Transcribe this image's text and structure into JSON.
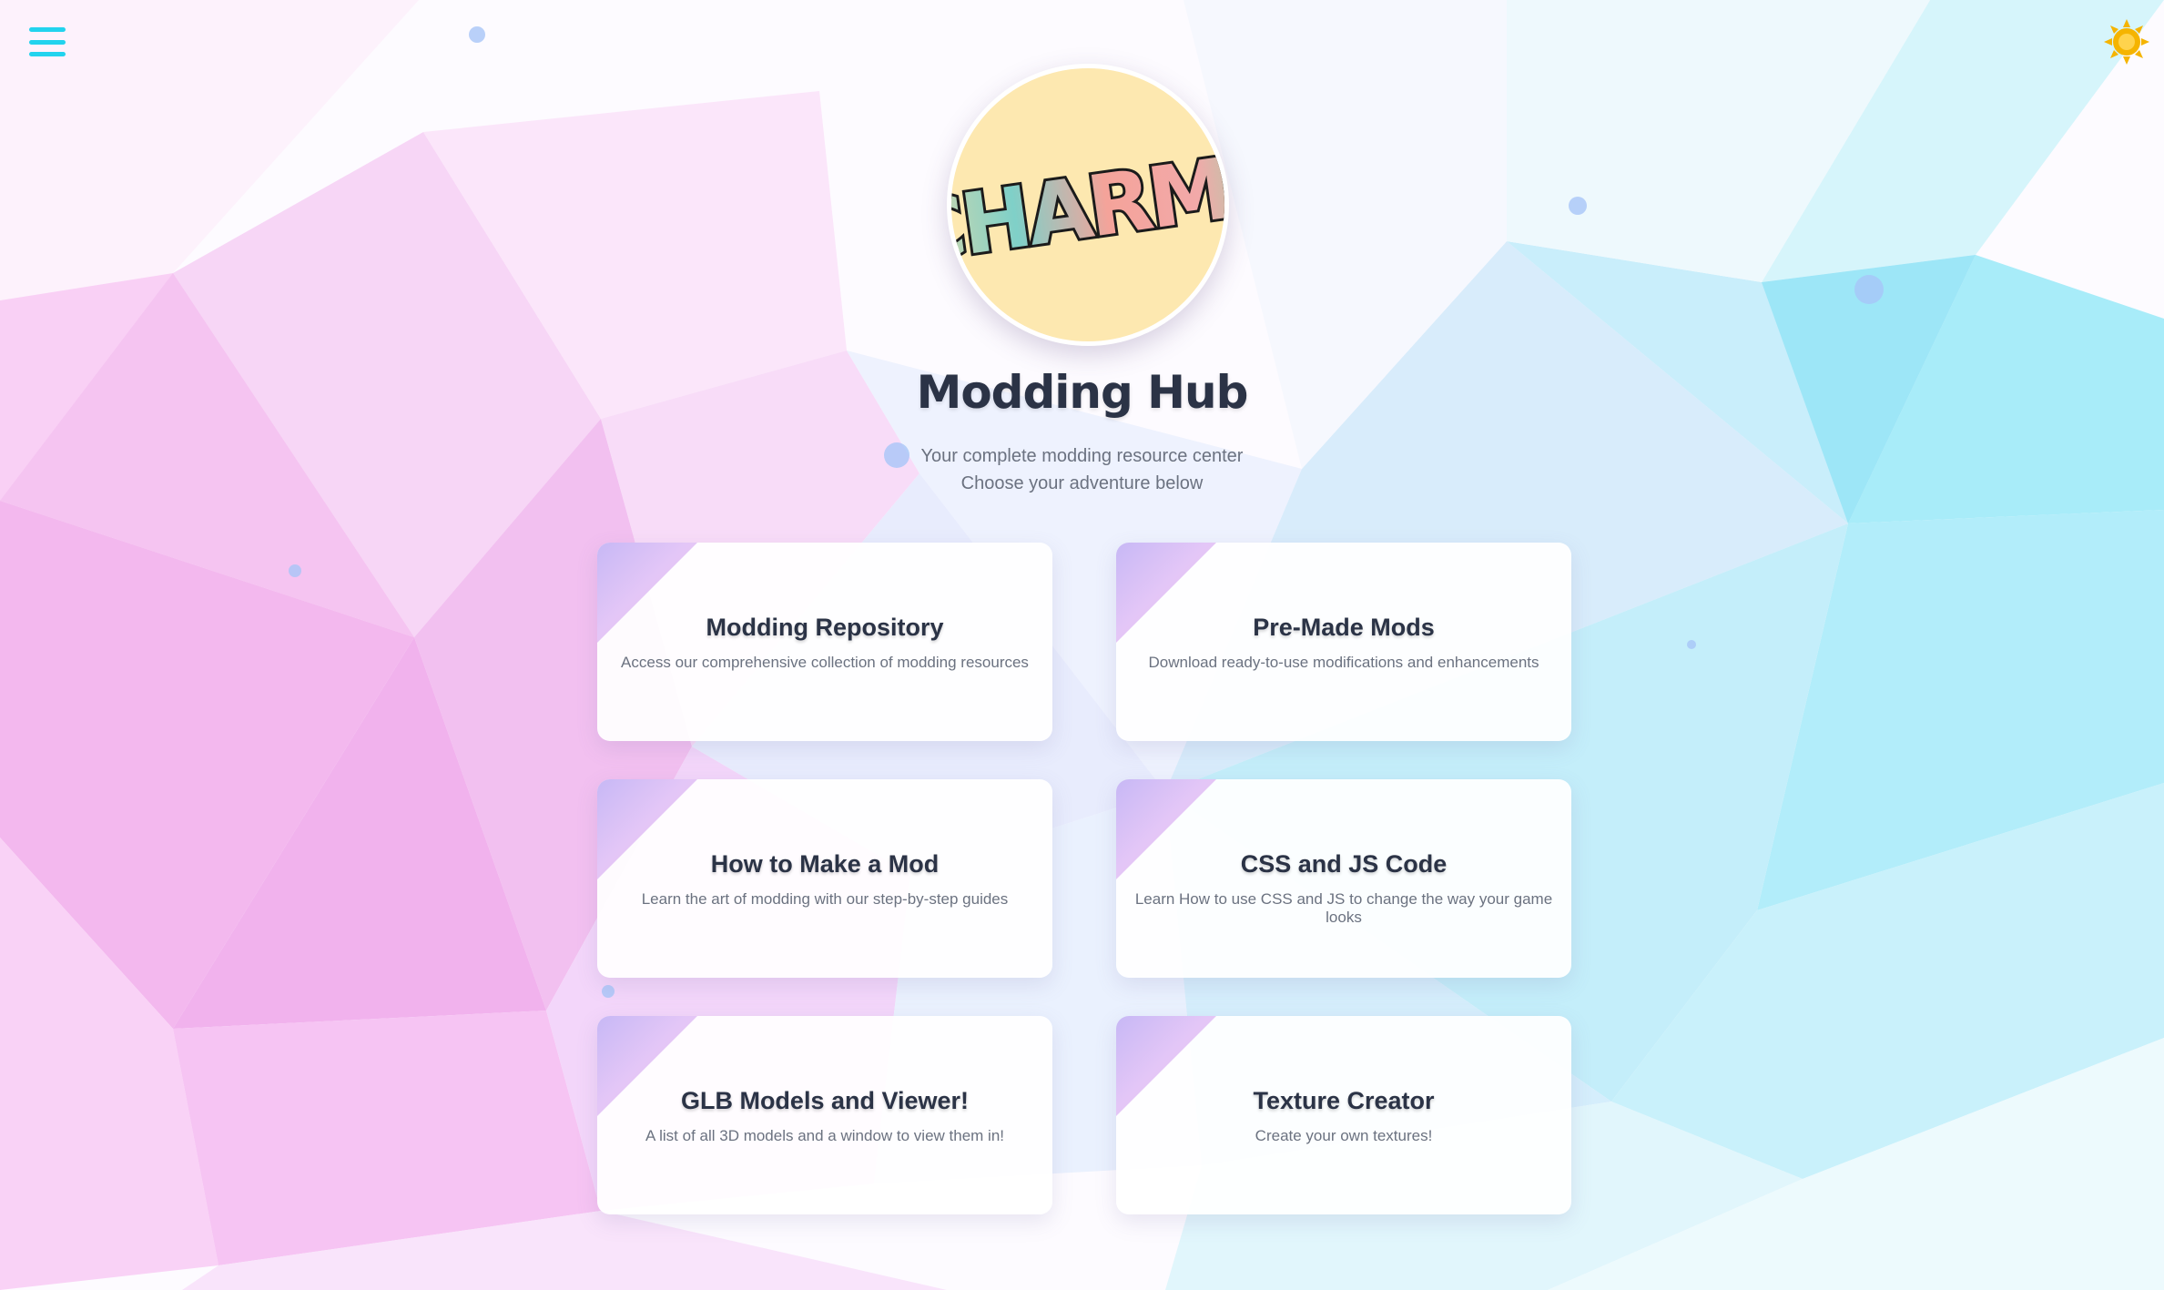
{
  "header": {
    "menu_icon": "hamburger-menu-icon",
    "theme_icon": "sun-icon",
    "logo_text": "CHARM?",
    "title": "Modding Hub",
    "subtitle_line1": "Your complete modding resource center",
    "subtitle_line2": "Choose your adventure below"
  },
  "colors": {
    "accent": "#22d3ee",
    "sun": "#f5b400",
    "title": "#2b3346",
    "muted": "#6b7280",
    "logo_bg": "#fde8b0"
  },
  "cards": [
    {
      "title": "Modding Repository",
      "desc": "Access our comprehensive collection of modding resources"
    },
    {
      "title": "Pre-Made Mods",
      "desc": "Download ready-to-use modifications and enhancements"
    },
    {
      "title": "How to Make a Mod",
      "desc": "Learn the art of modding with our step-by-step guides"
    },
    {
      "title": "CSS and JS Code",
      "desc": "Learn How to use CSS and JS to change the way your game looks"
    },
    {
      "title": "GLB Models and Viewer!",
      "desc": "A list of all 3D models and a window to view them in!"
    },
    {
      "title": "Texture Creator",
      "desc": "Create your own textures!"
    }
  ]
}
